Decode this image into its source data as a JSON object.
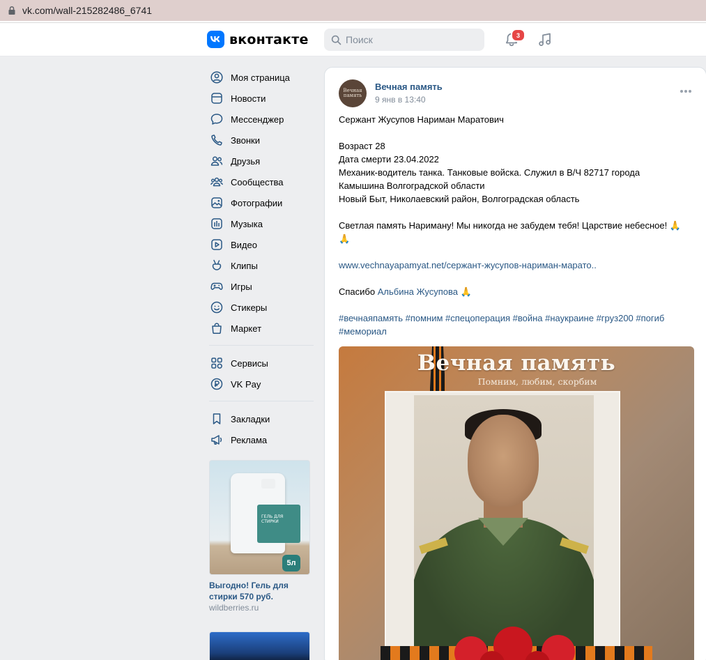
{
  "browser": {
    "url": "vk.com/wall-215282486_6741"
  },
  "header": {
    "logo_text": "вконтакте",
    "search_placeholder": "Поиск",
    "notifications_count": "3",
    "accent_color": "#0077ff"
  },
  "sidebar": {
    "items": [
      {
        "label": "Моя страница",
        "icon": "user-circle-icon"
      },
      {
        "label": "Новости",
        "icon": "newspaper-icon"
      },
      {
        "label": "Мессенджер",
        "icon": "message-bubble-icon"
      },
      {
        "label": "Звонки",
        "icon": "phone-icon"
      },
      {
        "label": "Друзья",
        "icon": "friends-icon"
      },
      {
        "label": "Сообщества",
        "icon": "communities-icon"
      },
      {
        "label": "Фотографии",
        "icon": "photo-icon"
      },
      {
        "label": "Музыка",
        "icon": "music-icon"
      },
      {
        "label": "Видео",
        "icon": "video-icon"
      },
      {
        "label": "Клипы",
        "icon": "clips-icon"
      },
      {
        "label": "Игры",
        "icon": "gamepad-icon"
      },
      {
        "label": "Стикеры",
        "icon": "sticker-icon"
      },
      {
        "label": "Маркет",
        "icon": "market-bag-icon"
      }
    ],
    "items2": [
      {
        "label": "Сервисы",
        "icon": "services-icon"
      },
      {
        "label": "VK Pay",
        "icon": "vkpay-icon"
      }
    ],
    "items3": [
      {
        "label": "Закладки",
        "icon": "bookmark-icon"
      },
      {
        "label": "Реклама",
        "icon": "megaphone-icon"
      }
    ]
  },
  "ad": {
    "title": "Выгодно! Гель для стирки 570 руб.",
    "domain": "wildberries.ru",
    "volume": "5л",
    "label_text": "ГЕЛЬ ДЛЯ СТИРКИ"
  },
  "post": {
    "author": "Вечная память",
    "avatar_text": "Вечная память",
    "date": "9 янв в 13:40",
    "line1": "Сержант Жусупов Нариман Маратович",
    "line2": "Возраст 28",
    "line3": "Дата смерти 23.04.2022",
    "line4": "Механик-водитель танка. Танковые войска. Служил в В/Ч 82717 города",
    "line5": "Камышина Волгоградской области",
    "line6": "Новый Быт, Николаевский район, Волгоградская область",
    "line7": "Светлая память Нариману! Мы никогда не забудем тебя! Царствие небесное! 🙏",
    "line8": "🙏",
    "link": "www.vechnayapamyat.net/сержант-жусупов-нариман-марато..",
    "thanks_prefix": "Спасибо ",
    "thanks_name": "Альбина Жусупова",
    "thanks_suffix": " 🙏",
    "tags_line1": "#вечнаяпамять #помним #спецоперация #война #наукраине #груз200 #погиб",
    "tags_line2": "#мемориал",
    "photo_title": "Вечная память",
    "photo_subtitle": "Помним, любим, скорбим"
  }
}
